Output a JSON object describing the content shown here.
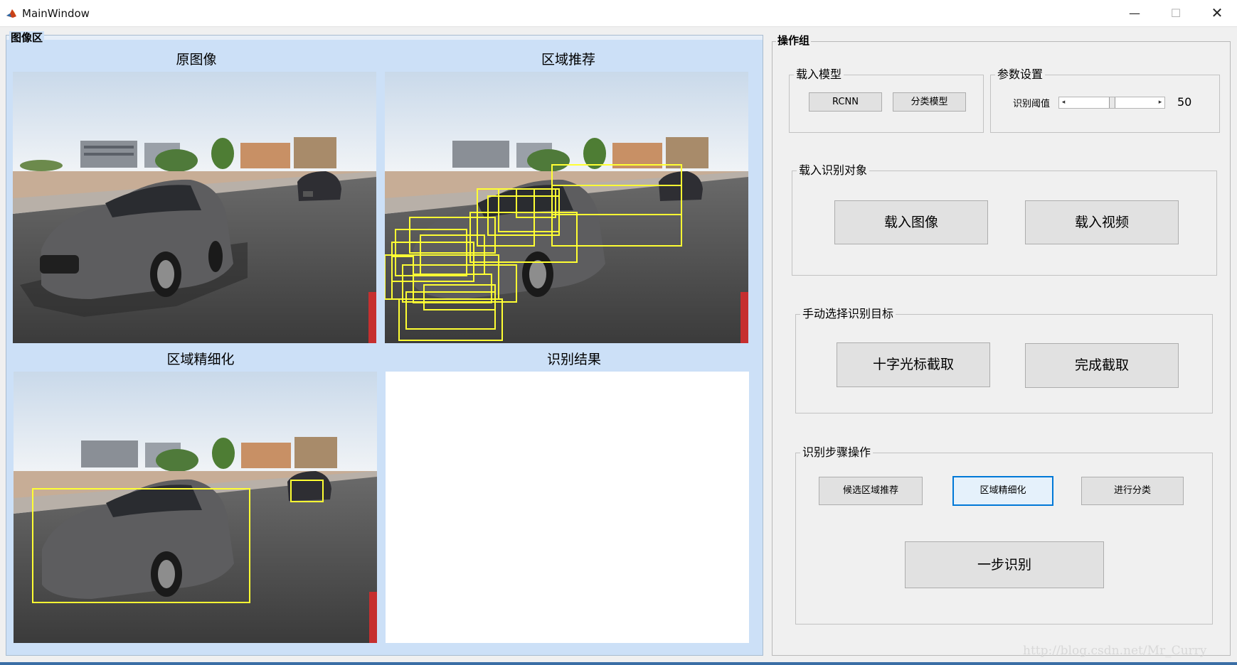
{
  "window": {
    "title": "MainWindow",
    "minimize": "—",
    "maximize": "☐",
    "close": "✕"
  },
  "image_group": {
    "title": "图像区",
    "panels": {
      "original": "原图像",
      "proposals": "区域推荐",
      "refined": "区域精细化",
      "result": "识别结果"
    }
  },
  "op_group": {
    "title": "操作组",
    "load_model": {
      "title": "载入模型",
      "rcnn_button": "RCNN",
      "classify_button": "分类模型"
    },
    "params": {
      "title": "参数设置",
      "threshold_label": "识别阈值",
      "threshold_value": "50",
      "threshold_fraction": 0.5
    },
    "load_target": {
      "title": "载入识别对象",
      "image_button": "载入图像",
      "video_button": "载入视频"
    },
    "manual_select": {
      "title": "手动选择识别目标",
      "crosshair_button": "十字光标截取",
      "finish_button": "完成截取"
    },
    "steps": {
      "title": "识别步骤操作",
      "propose_button": "候选区域推荐",
      "refine_button": "区域精细化",
      "classify_button": "进行分类",
      "one_step_button": "一步识别"
    }
  },
  "watermark": "http://blog.csdn.net/Mr_Curry",
  "colors": {
    "image_area_bg": "#cce0f7",
    "detection_box": "#ffff33",
    "focus_border": "#0078d7"
  }
}
